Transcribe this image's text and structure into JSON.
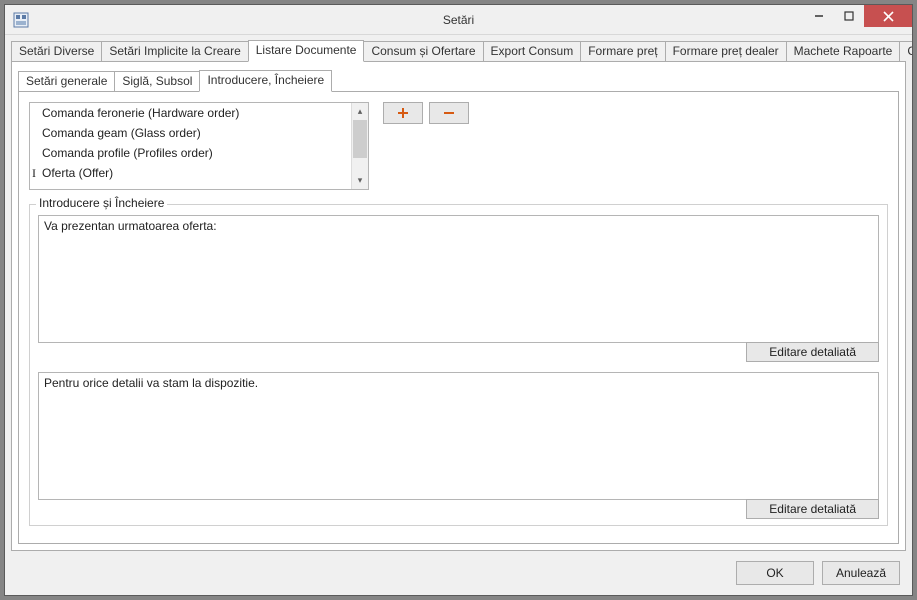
{
  "window": {
    "title": "Setări"
  },
  "main_tabs": [
    "Setări Diverse",
    "Setări Implicite la Creare",
    "Listare Documente",
    "Consum și Ofertare",
    "Export Consum",
    "Formare preț",
    "Formare preț dealer",
    "Machete Rapoarte",
    "Conectarea la d"
  ],
  "main_tab_active_index": 2,
  "sub_tabs": [
    "Setări generale",
    "Siglă, Subsol",
    "Introducere, Încheiere"
  ],
  "sub_tab_active_index": 2,
  "document_list": [
    "Comanda feronerie (Hardware order)",
    "Comanda geam (Glass order)",
    "Comanda profile (Profiles order)",
    "Oferta (Offer)"
  ],
  "document_list_cursor_index": 3,
  "group": {
    "legend": "Introducere și Încheiere",
    "intro_text": "Va prezentan urmatoarea oferta:",
    "outro_text": "Pentru orice detalii va stam la dispozitie.",
    "edit_button_label": "Editare detaliată"
  },
  "buttons": {
    "ok": "OK",
    "cancel": "Anulează"
  },
  "icons": {
    "plus": "plus-icon",
    "minus": "minus-icon"
  }
}
